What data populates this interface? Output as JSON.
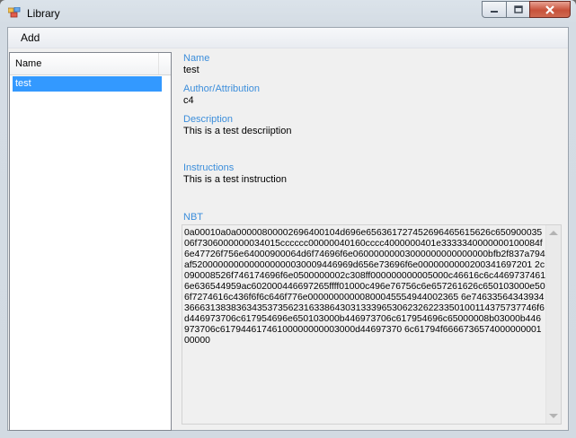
{
  "window": {
    "title": "Library",
    "controls": {
      "minimize": "minimize",
      "maximize": "maximize",
      "close": "close"
    }
  },
  "menu": {
    "items": [
      {
        "label": "Add"
      }
    ]
  },
  "list": {
    "columns": [
      {
        "label": "Name"
      }
    ],
    "items": [
      {
        "label": "test",
        "selected": true
      }
    ]
  },
  "details": {
    "name": {
      "label": "Name",
      "value": "test"
    },
    "author": {
      "label": "Author/Attribution",
      "value": "c4"
    },
    "description": {
      "label": "Description",
      "value": "This is a test descriiption"
    },
    "instructions": {
      "label": "Instructions",
      "value": "This is a test instruction"
    },
    "nbt": {
      "label": "NBT",
      "value": "0a00010a0a00000800002696400104d696e656361727452696465615626c65090003506f7306000000034015cccccc00000040160cccc4000000401e3333340000000100084f6e47726f756e64000900064d6f74696f6e06000000003000000000000000bfb2f837a794af5200000000000000000030009446969d656e73696f6e0000000000200341697201 2c090008526f746174696f6e0500000002c308ff000000000005000c46616c6c44697374616e636544959ac602000446697265ffff01000c496e76756c6e657261626c650103000e506f7274616c436f6f6c646f776e00000000000800045554944002365 6e7463356434393436663138383634353735623163386430313339653062326223350100114375737746f6d446973706c617954696e650103000b446973706c617954696c65000008b03000b446973706c61794461746100000000003000d44697370 6c61794f666673657400000000100000"
    }
  },
  "colors": {
    "label_accent": "#3c8edb",
    "selection": "#3399ff",
    "close_button": "#c7523b"
  }
}
